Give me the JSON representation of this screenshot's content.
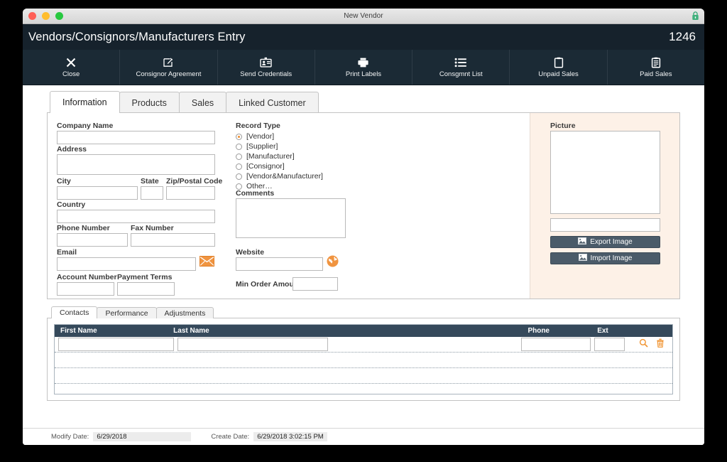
{
  "window": {
    "title": "New Vendor",
    "traffic_lights": [
      "close",
      "minimize",
      "maximize"
    ],
    "lock_icon": "lock-icon"
  },
  "header": {
    "title": "Vendors/Consignors/Manufacturers Entry",
    "record_id": "1246"
  },
  "toolbar": {
    "buttons": [
      {
        "label": "Close",
        "icon": "close-x-icon"
      },
      {
        "label": "Consignor Agreement",
        "icon": "document-edit-icon"
      },
      {
        "label": "Send Credentials",
        "icon": "id-badge-icon"
      },
      {
        "label": "Print Labels",
        "icon": "printer-icon"
      },
      {
        "label": "Consgmnt List",
        "icon": "list-icon"
      },
      {
        "label": "Unpaid Sales",
        "icon": "clipboard-icon"
      },
      {
        "label": "Paid Sales",
        "icon": "clipboard-lines-icon"
      }
    ]
  },
  "tabs": [
    {
      "label": "Information",
      "active": true
    },
    {
      "label": "Products",
      "active": false
    },
    {
      "label": "Sales",
      "active": false
    },
    {
      "label": "Linked Customer",
      "active": false
    }
  ],
  "form": {
    "company_name": {
      "label": "Company Name",
      "value": "",
      "placeholder": ""
    },
    "address": {
      "label": "Address",
      "value": "",
      "placeholder": ""
    },
    "city": {
      "label": "City",
      "value": "",
      "placeholder": ""
    },
    "state": {
      "label": "State",
      "value": "",
      "placeholder": ""
    },
    "zip": {
      "label": "Zip/Postal Code",
      "value": "",
      "placeholder": ""
    },
    "country": {
      "label": "Country",
      "value": "",
      "placeholder": ""
    },
    "phone": {
      "label": "Phone Number",
      "value": "",
      "placeholder": ""
    },
    "fax": {
      "label": "Fax Number",
      "value": "",
      "placeholder": ""
    },
    "email": {
      "label": "Email",
      "value": "",
      "placeholder": "",
      "icon": "envelope-icon"
    },
    "account_number": {
      "label": "Account Number",
      "value": "",
      "placeholder": ""
    },
    "payment_terms": {
      "label": "Payment Terms",
      "value": "",
      "placeholder": ""
    },
    "record_type": {
      "label": "Record Type",
      "options": [
        {
          "label": "[Vendor]",
          "selected": true
        },
        {
          "label": "[Supplier]",
          "selected": false
        },
        {
          "label": "[Manufacturer]",
          "selected": false
        },
        {
          "label": "[Consignor]",
          "selected": false
        },
        {
          "label": "[Vendor&Manufacturer]",
          "selected": false
        },
        {
          "label": "Other…",
          "selected": false
        }
      ]
    },
    "comments": {
      "label": "Comments",
      "value": "",
      "placeholder": ""
    },
    "website": {
      "label": "Website",
      "value": "",
      "placeholder": "",
      "icon": "globe-icon"
    },
    "min_order_amount": {
      "label": "Min Order Amount",
      "value": "",
      "placeholder": ""
    }
  },
  "picture": {
    "label": "Picture",
    "filename": "",
    "export_label": "Export Image",
    "import_label": "Import Image",
    "export_icon": "image-icon",
    "import_icon": "image-icon"
  },
  "subtabs": [
    {
      "label": "Contacts",
      "active": true
    },
    {
      "label": "Performance",
      "active": false
    },
    {
      "label": "Adjustments",
      "active": false
    }
  ],
  "contacts_grid": {
    "columns": [
      "First Name",
      "Last Name",
      "Phone",
      "Ext"
    ],
    "rows": [
      {
        "first_name": "",
        "last_name": "",
        "phone": "",
        "ext": "",
        "search_icon": "magnifier-icon",
        "delete_icon": "trash-icon"
      }
    ],
    "empty_rows": 3
  },
  "statusbar": {
    "modify_label": "Modify Date:",
    "modify_value": "6/29/2018",
    "create_label": "Create Date:",
    "create_value": "6/29/2018 3:02:15 PM"
  },
  "colors": {
    "header_bg": "#16222c",
    "toolbar_bg": "#1b2a35",
    "accent_orange": "#ef8c2a",
    "picture_pane_bg": "#fdf1e7",
    "grid_header_bg": "#35495b",
    "button_bg": "#4b5b69"
  }
}
